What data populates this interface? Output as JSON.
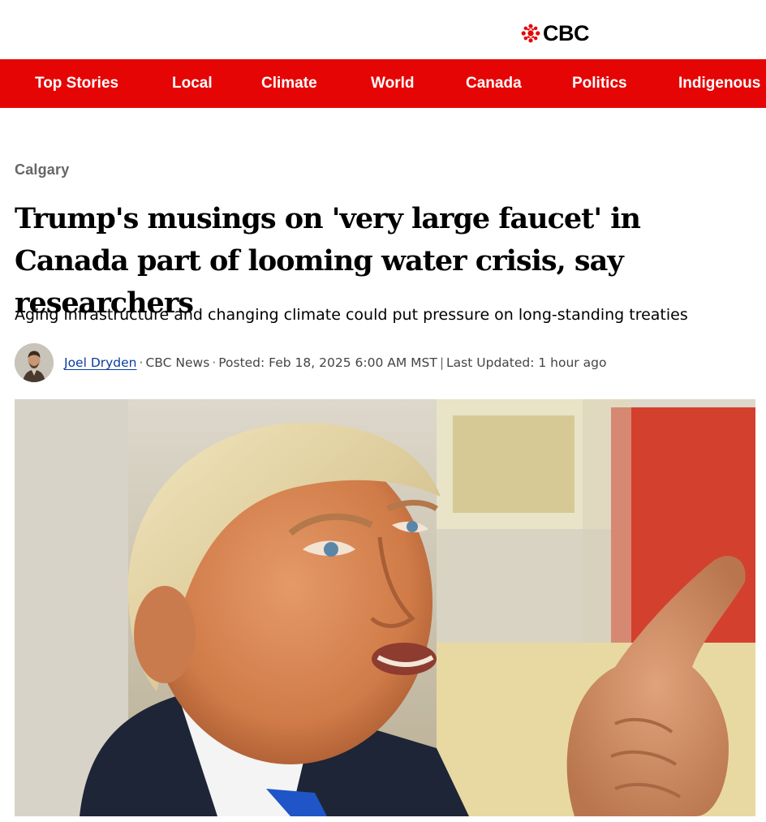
{
  "brand": {
    "logo_text": "CBC",
    "logo_icon": "cbc-gem-icon",
    "accent": "#e60505"
  },
  "nav": {
    "items": [
      {
        "label": "Top Stories"
      },
      {
        "label": "Local"
      },
      {
        "label": "Climate"
      },
      {
        "label": "World"
      },
      {
        "label": "Canada"
      },
      {
        "label": "Politics"
      },
      {
        "label": "Indigenous"
      }
    ]
  },
  "article": {
    "section": "Calgary",
    "headline": "Trump's musings on 'very large faucet' in Canada part of looming water crisis, say researchers",
    "deck": "Aging infrastructure and changing climate could put pressure on long-standing treaties",
    "byline": {
      "author": "Joel Dryden",
      "outlet": "CBC News",
      "posted": "Posted: Feb 18, 2025 6:00 AM MST",
      "updated": "Last Updated: 1 hour ago"
    },
    "hero_image": "photo of man in suit pointing finger"
  }
}
